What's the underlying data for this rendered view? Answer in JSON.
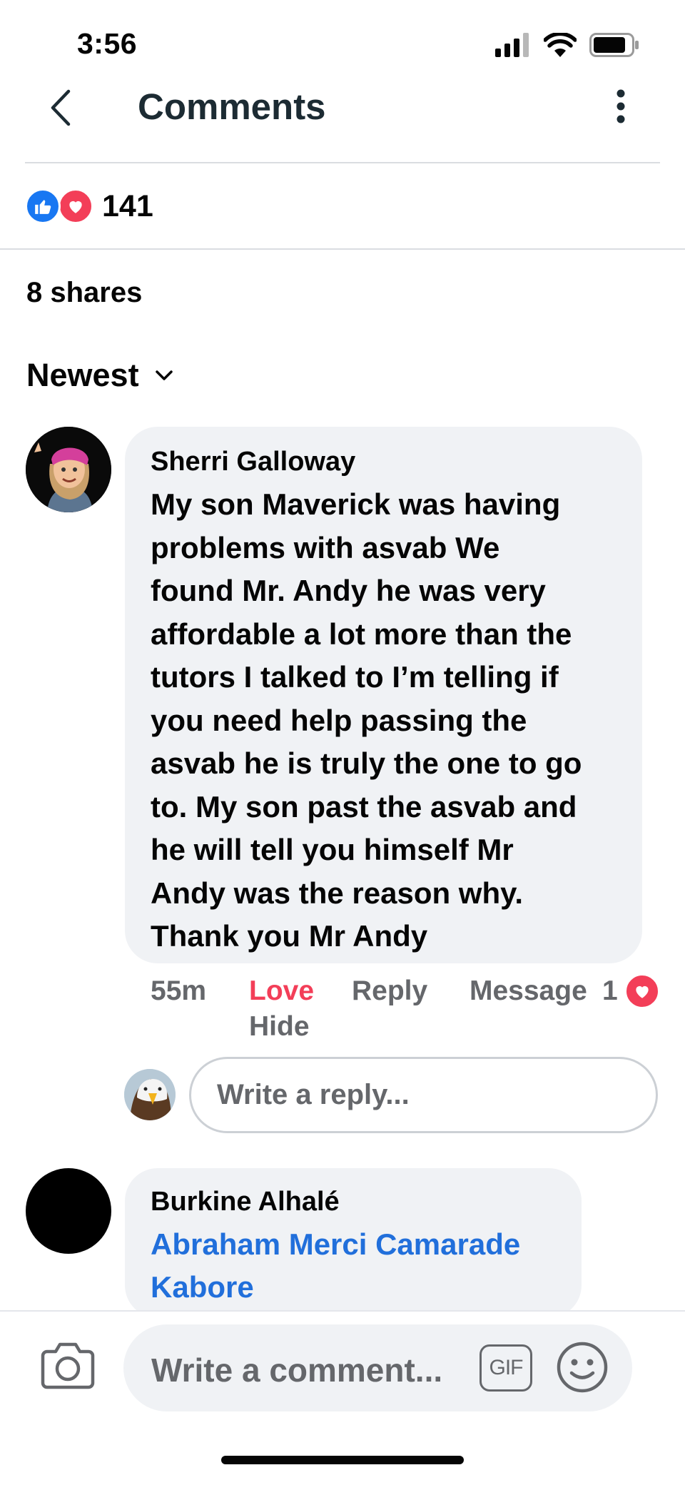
{
  "status_bar": {
    "time": "3:56",
    "icons": [
      "signal-icon",
      "wifi-icon",
      "battery-icon"
    ]
  },
  "header": {
    "title": "Comments",
    "back_icon": "chevron-left-icon",
    "more_icon": "more-vertical-icon"
  },
  "reactions": {
    "count": "141",
    "types": [
      "like",
      "love"
    ]
  },
  "shares": "8 shares",
  "sort": {
    "label": "Newest"
  },
  "comments": [
    {
      "author": "Sherri Galloway",
      "text_lines": [
        "My son Maverick was having",
        "problems with asvab   We",
        "found Mr. Andy he was very",
        "affordable a lot more than the",
        "tutors I talked to   I’m telling if",
        "you need help passing the",
        "asvab he is truly the one to go",
        "to. My son past the asvab and",
        "he will tell you himself Mr",
        "Andy was the reason why.",
        "Thank you Mr Andy"
      ],
      "time": "55m",
      "love_label": "Love",
      "reply_label": "Reply",
      "message_label": "Message",
      "hide_label": "Hide",
      "reaction_count": "1"
    },
    {
      "author": "Burkine Alhalé",
      "text_lines": [
        "Abraham Merci Camarade",
        "Kabore"
      ]
    }
  ],
  "reply_input": {
    "placeholder": "Write a reply..."
  },
  "composer": {
    "placeholder": "Write a comment...",
    "gif_label": "GIF"
  },
  "colors": {
    "accent": "#1877f2",
    "love": "#f33e58",
    "bubble": "#f0f2f5",
    "link": "#216fdb",
    "muted": "#65676b"
  }
}
